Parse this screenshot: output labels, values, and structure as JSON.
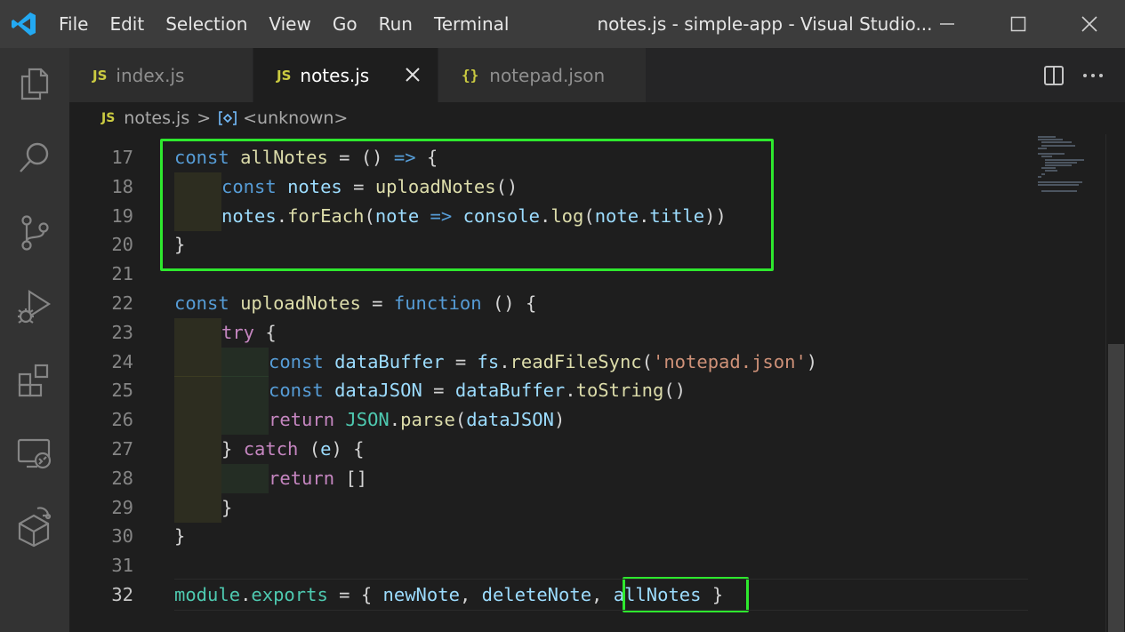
{
  "titlebar": {
    "menu": [
      "File",
      "Edit",
      "Selection",
      "View",
      "Go",
      "Run",
      "Terminal"
    ],
    "title": "notes.js - simple-app - Visual Studio..."
  },
  "tabs": [
    {
      "badge": "JS",
      "label": "index.js",
      "active": false
    },
    {
      "badge": "JS",
      "label": "notes.js",
      "active": true
    },
    {
      "badge": "{}",
      "label": "notepad.json",
      "active": false
    }
  ],
  "breadcrumb": {
    "badge": "JS",
    "file": "notes.js",
    "separator": ">",
    "symbol": "<unknown>"
  },
  "editor": {
    "lines": [
      {
        "n": "17",
        "indent": 0,
        "tokens": [
          [
            "kw",
            "const"
          ],
          [
            "pl",
            " "
          ],
          [
            "fn",
            "allNotes"
          ],
          [
            "pl",
            " = () "
          ],
          [
            "kw",
            "=>"
          ],
          [
            "pl",
            " {"
          ]
        ]
      },
      {
        "n": "18",
        "indent": 1,
        "tokens": [
          [
            "kw",
            "const"
          ],
          [
            "pl",
            " "
          ],
          [
            "var",
            "notes"
          ],
          [
            "pl",
            " = "
          ],
          [
            "fn",
            "uploadNotes"
          ],
          [
            "pl",
            "()"
          ]
        ]
      },
      {
        "n": "19",
        "indent": 1,
        "tokens": [
          [
            "var",
            "notes"
          ],
          [
            "pl",
            "."
          ],
          [
            "fn",
            "forEach"
          ],
          [
            "pl",
            "("
          ],
          [
            "var",
            "note"
          ],
          [
            "pl",
            " "
          ],
          [
            "kw",
            "=>"
          ],
          [
            "pl",
            " "
          ],
          [
            "var",
            "console"
          ],
          [
            "pl",
            "."
          ],
          [
            "fn",
            "log"
          ],
          [
            "pl",
            "("
          ],
          [
            "var",
            "note"
          ],
          [
            "pl",
            "."
          ],
          [
            "var",
            "title"
          ],
          [
            "pl",
            "))"
          ]
        ]
      },
      {
        "n": "20",
        "indent": 0,
        "tokens": [
          [
            "pl",
            "}"
          ]
        ]
      },
      {
        "n": "21",
        "indent": 0,
        "tokens": []
      },
      {
        "n": "22",
        "indent": 0,
        "tokens": [
          [
            "kw",
            "const"
          ],
          [
            "pl",
            " "
          ],
          [
            "fn",
            "uploadNotes"
          ],
          [
            "pl",
            " = "
          ],
          [
            "kw",
            "function"
          ],
          [
            "pl",
            " () {"
          ]
        ]
      },
      {
        "n": "23",
        "indent": 1,
        "tokens": [
          [
            "ctl",
            "try"
          ],
          [
            "pl",
            " {"
          ]
        ]
      },
      {
        "n": "24",
        "indent": 2,
        "tokens": [
          [
            "kw",
            "const"
          ],
          [
            "pl",
            " "
          ],
          [
            "var",
            "dataBuffer"
          ],
          [
            "pl",
            " = "
          ],
          [
            "var",
            "fs"
          ],
          [
            "pl",
            "."
          ],
          [
            "fn",
            "readFileSync"
          ],
          [
            "pl",
            "("
          ],
          [
            "str",
            "'notepad.json'"
          ],
          [
            "pl",
            ")"
          ]
        ]
      },
      {
        "n": "25",
        "indent": 2,
        "tokens": [
          [
            "kw",
            "const"
          ],
          [
            "pl",
            " "
          ],
          [
            "var",
            "dataJSON"
          ],
          [
            "pl",
            " = "
          ],
          [
            "var",
            "dataBuffer"
          ],
          [
            "pl",
            "."
          ],
          [
            "fn",
            "toString"
          ],
          [
            "pl",
            "()"
          ]
        ]
      },
      {
        "n": "26",
        "indent": 2,
        "tokens": [
          [
            "ctl",
            "return"
          ],
          [
            "pl",
            " "
          ],
          [
            "cls",
            "JSON"
          ],
          [
            "pl",
            "."
          ],
          [
            "fn",
            "parse"
          ],
          [
            "pl",
            "("
          ],
          [
            "var",
            "dataJSON"
          ],
          [
            "pl",
            ")"
          ]
        ]
      },
      {
        "n": "27",
        "indent": 1,
        "tokens": [
          [
            "pl",
            "} "
          ],
          [
            "ctl",
            "catch"
          ],
          [
            "pl",
            " ("
          ],
          [
            "var",
            "e"
          ],
          [
            "pl",
            ") {"
          ]
        ]
      },
      {
        "n": "28",
        "indent": 2,
        "tokens": [
          [
            "ctl",
            "return"
          ],
          [
            "pl",
            " []"
          ]
        ]
      },
      {
        "n": "29",
        "indent": 1,
        "tokens": [
          [
            "pl",
            "}"
          ]
        ]
      },
      {
        "n": "30",
        "indent": 0,
        "tokens": [
          [
            "pl",
            "}"
          ]
        ]
      },
      {
        "n": "31",
        "indent": 0,
        "tokens": []
      },
      {
        "n": "32",
        "indent": 0,
        "current": true,
        "tokens": [
          [
            "cls",
            "module"
          ],
          [
            "pl",
            "."
          ],
          [
            "cls",
            "exports"
          ],
          [
            "pl",
            " = { "
          ],
          [
            "var",
            "newNote"
          ],
          [
            "pl",
            ", "
          ],
          [
            "var",
            "deleteNote"
          ],
          [
            "pl",
            ", "
          ],
          [
            "var",
            "allNotes"
          ],
          [
            "pl",
            " }"
          ]
        ]
      }
    ]
  },
  "colors": {
    "highlight_box": "#2ee82e",
    "keyword": "#569cd6",
    "control": "#c586c0",
    "variable": "#9cdcfe",
    "function": "#dcdcaa",
    "string": "#ce9178",
    "class": "#4ec9b0"
  },
  "icons": {
    "activity": [
      "explorer-icon",
      "search-icon",
      "source-control-icon",
      "run-debug-icon",
      "extensions-icon",
      "remote-explorer-icon",
      "docker-icon"
    ]
  }
}
